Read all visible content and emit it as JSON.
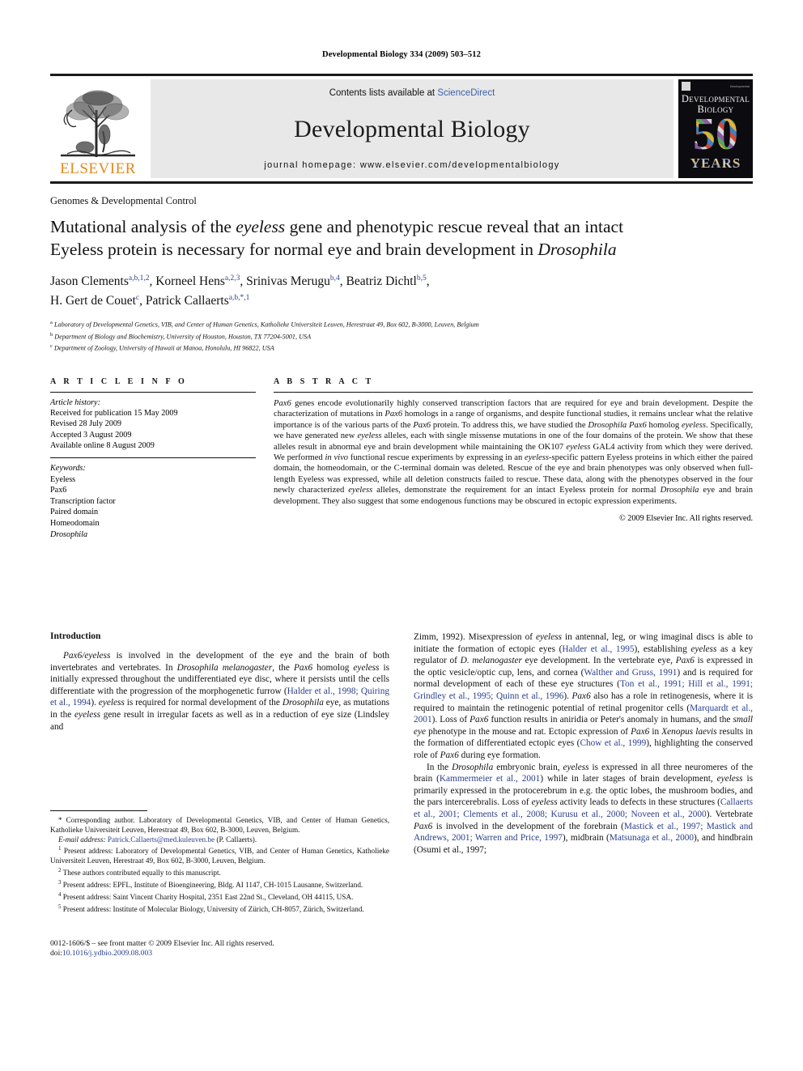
{
  "running_head": "Developmental Biology 334 (2009) 503–512",
  "masthead": {
    "contents_prefix": "Contents lists available at ",
    "sciencedirect": "ScienceDirect",
    "journal_name": "Developmental Biology",
    "homepage": "journal homepage: www.elsevier.com/developmentalbiology",
    "elsevier_wordmark": "ELSEVIER",
    "cover": {
      "title_line1": "Developmental",
      "title_line2": "Biology",
      "anniversary_number": "50",
      "anniversary_word": "YEARS",
      "publisher_mark": "ELSEVIER"
    }
  },
  "section_tag": "Genomes & Developmental Control",
  "title": {
    "line1_a": "Mutational analysis of the ",
    "line1_em": "eyeless",
    "line1_b": " gene and phenotypic rescue reveal that an intact",
    "line2_a": "Eyeless protein is necessary for normal eye and brain development in ",
    "line2_em": "Drosophila"
  },
  "authors": [
    {
      "name": "Jason Clements",
      "sup": "a,b,1,2",
      "sep": ", "
    },
    {
      "name": "Korneel Hens",
      "sup": "a,2,3",
      "sep": ", "
    },
    {
      "name": "Srinivas Merugu",
      "sup": "b,4",
      "sep": ", "
    },
    {
      "name": "Beatriz Dichtl",
      "sup": "b,5",
      "sep": ","
    },
    {
      "name": "H. Gert de Couet",
      "sup": "c",
      "sep": ", "
    },
    {
      "name": "Patrick Callaerts",
      "sup": "a,b,*,1",
      "sep": ""
    }
  ],
  "affiliations": [
    {
      "mark": "a",
      "text": "Laboratory of Developmental Genetics, VIB, and Center of Human Genetics, Katholieke Universiteit Leuven, Herestraat 49, Box 602, B-3000, Leuven, Belgium"
    },
    {
      "mark": "b",
      "text": "Department of Biology and Biochemistry, University of Houston, Houston, TX 77204-5001, USA"
    },
    {
      "mark": "c",
      "text": "Department of Zoology, University of Hawaii at Manoa, Honolulu, HI 96822, USA"
    }
  ],
  "article_info": {
    "heading": "A R T I C L E  I N F O",
    "history_label": "Article history:",
    "history": [
      "Received for publication 15 May 2009",
      "Revised 28 July 2009",
      "Accepted 3 August 2009",
      "Available online 8 August 2009"
    ],
    "keywords_label": "Keywords:",
    "keywords": [
      "Eyeless",
      "Pax6",
      "Transcription factor",
      "Paired domain",
      "Homeodomain",
      "Drosophila"
    ],
    "keywords_italic_index": 5
  },
  "abstract": {
    "heading": "A B S T R A C T",
    "text": "Pax6 genes encode evolutionarily highly conserved transcription factors that are required for eye and brain development. Despite the characterization of mutations in Pax6 homologs in a range of organisms, and despite functional studies, it remains unclear what the relative importance is of the various parts of the Pax6 protein. To address this, we have studied the Drosophila Pax6 homolog eyeless. Specifically, we have generated new eyeless alleles, each with single missense mutations in one of the four domains of the protein. We show that these alleles result in abnormal eye and brain development while maintaining the OK107 eyeless GAL4 activity from which they were derived. We performed in vivo functional rescue experiments by expressing in an eyeless-specific pattern Eyeless proteins in which either the paired domain, the homeodomain, or the C-terminal domain was deleted. Rescue of the eye and brain phenotypes was only observed when full-length Eyeless was expressed, while all deletion constructs failed to rescue. These data, along with the phenotypes observed in the four newly characterized eyeless alleles, demonstrate the requirement for an intact Eyeless protein for normal Drosophila eye and brain development. They also suggest that some endogenous functions may be obscured in ectopic expression experiments.",
    "copyright": "© 2009 Elsevier Inc. All rights reserved."
  },
  "introduction": {
    "heading": "Introduction",
    "left_paragraph": "Pax6/eyeless is involved in the development of the eye and the brain of both invertebrates and vertebrates. In Drosophila melanogaster, the Pax6 homolog eyeless is initially expressed throughout the undifferentiated eye disc, where it persists until the cells differentiate with the progression of the morphogenetic furrow (Halder et al., 1998; Quiring et al., 1994). eyeless is required for normal development of the Drosophila eye, as mutations in the eyeless gene result in irregular facets as well as in a reduction of eye size (Lindsley and",
    "right_paragraph_1": "Zimm, 1992). Misexpression of eyeless in antennal, leg, or wing imaginal discs is able to initiate the formation of ectopic eyes (Halder et al., 1995), establishing eyeless as a key regulator of D. melanogaster eye development. In the vertebrate eye, Pax6 is expressed in the optic vesicle/optic cup, lens, and cornea (Walther and Gruss, 1991) and is required for normal development of each of these eye structures (Ton et al., 1991; Hill et al., 1991; Grindley et al., 1995; Quinn et al., 1996). Pax6 also has a role in retinogenesis, where it is required to maintain the retinogenic potential of retinal progenitor cells (Marquardt et al., 2001). Loss of Pax6 function results in aniridia or Peter's anomaly in humans, and the small eye phenotype in the mouse and rat. Ectopic expression of Pax6 in Xenopus laevis results in the formation of differentiated ectopic eyes (Chow et al., 1999), highlighting the conserved role of Pax6 during eye formation.",
    "right_paragraph_2": "In the Drosophila embryonic brain, eyeless is expressed in all three neuromeres of the brain (Kammermeier et al., 2001) while in later stages of brain development, eyeless is primarily expressed in the protocerebrum in e.g. the optic lobes, the mushroom bodies, and the pars intercerebralis. Loss of eyeless activity leads to defects in these structures (Callaerts et al., 2001; Clements et al., 2008; Kurusu et al., 2000; Noveen et al., 2000). Vertebrate Pax6 is involved in the development of the forebrain (Mastick et al., 1997; Mastick and Andrews, 2001; Warren and Price, 1997), midbrain (Matsunaga et al., 2000), and hindbrain (Osumi et al., 1997;"
  },
  "footnotes": {
    "corresponding": "* Corresponding author. Laboratory of Developmental Genetics, VIB, and Center of Human Genetics, Katholieke Universiteit Leuven, Herestraat 49, Box 602, B-3000, Leuven, Belgium.",
    "email_label": "E-mail address:",
    "email": "Patrick.Callaerts@med.kuleuven.be",
    "email_suffix": "(P. Callaerts).",
    "numbered": [
      {
        "mark": "1",
        "text": "Present address: Laboratory of Developmental Genetics, VIB, and Center of Human Genetics, Katholieke Universiteit Leuven, Herestraat 49, Box 602, B-3000, Leuven, Belgium."
      },
      {
        "mark": "2",
        "text": "These authors contributed equally to this manuscript."
      },
      {
        "mark": "3",
        "text": "Present address: EPFL, Institute of Bioengineering, Bldg. AI 1147, CH-1015 Lausanne, Switzerland."
      },
      {
        "mark": "4",
        "text": "Present address: Saint Vincent Charity Hospital, 2351 East 22nd St., Cleveland, OH 44115, USA."
      },
      {
        "mark": "5",
        "text": "Present address: Institute of Molecular Biology, University of Zürich, CH-8057, Zürich, Switzerland."
      }
    ]
  },
  "imprint": {
    "line1": "0012-1606/$ – see front matter © 2009 Elsevier Inc. All rights reserved.",
    "doi_label": "doi:",
    "doi": "10.1016/j.ydbio.2009.08.003"
  },
  "colors": {
    "link": "#2a3e8c",
    "sciencedirect": "#3b5fa8",
    "elsevier_orange": "#e08a1e",
    "masthead_band": "#e8e8e8",
    "cover_bg": "#0c0c10"
  }
}
